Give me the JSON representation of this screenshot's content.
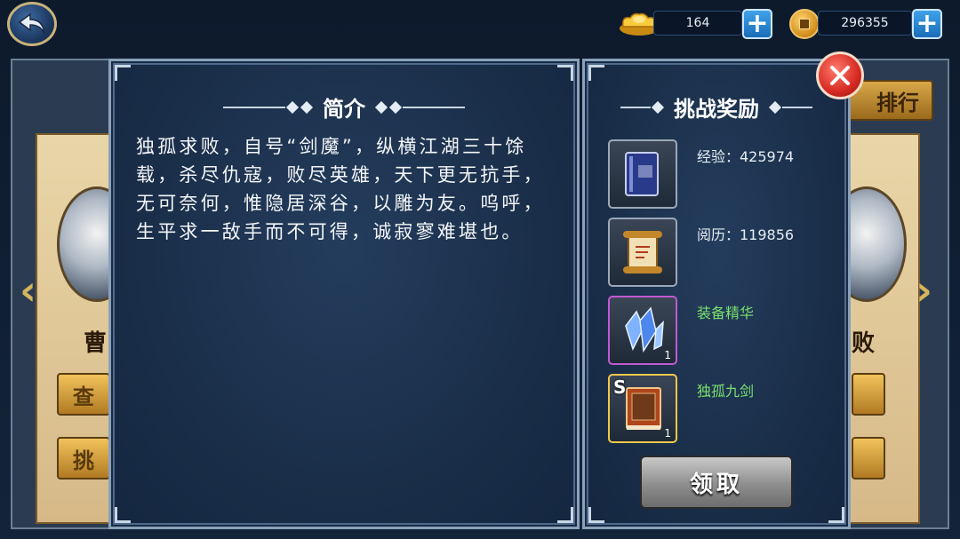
{
  "currency": {
    "ingot_value": "164",
    "coin_value": "296355",
    "plus_label": "+"
  },
  "background": {
    "left_name": "曹",
    "right_name": "败",
    "left_btn_1": "查",
    "left_btn_2": "挑",
    "rank_label": "排行",
    "left_arrow": "‹",
    "right_arrow": "›"
  },
  "intro": {
    "title": "简介",
    "text": "独孤求败，自号“剑魔”，纵横江湖三十馀载，杀尽仇寇，败尽英雄，天下更无抗手，无可奈何，惟隐居深谷，以雕为友。呜呼，生平求一敌手而不可得，诚寂寥难堪也。"
  },
  "rewards": {
    "title": "挑战奖励",
    "items": [
      {
        "label": "经验：425974",
        "icon": "exp-book-icon",
        "frame": "gray",
        "qty": "",
        "grade": ""
      },
      {
        "label": "阅历：119856",
        "icon": "scroll-icon",
        "frame": "gray",
        "qty": "",
        "grade": ""
      },
      {
        "label": "装备精华",
        "icon": "crystal-icon",
        "frame": "purple",
        "qty": "1",
        "grade": ""
      },
      {
        "label": "独孤九剑",
        "icon": "skill-book-icon",
        "frame": "gold",
        "qty": "1",
        "grade": "S"
      }
    ],
    "claim_label": "领取"
  },
  "colors": {
    "panel_bg": "#1a2e49",
    "green_text": "#7be06d",
    "plus_blue": "#2a8ad6",
    "close_red": "#d62a22"
  }
}
